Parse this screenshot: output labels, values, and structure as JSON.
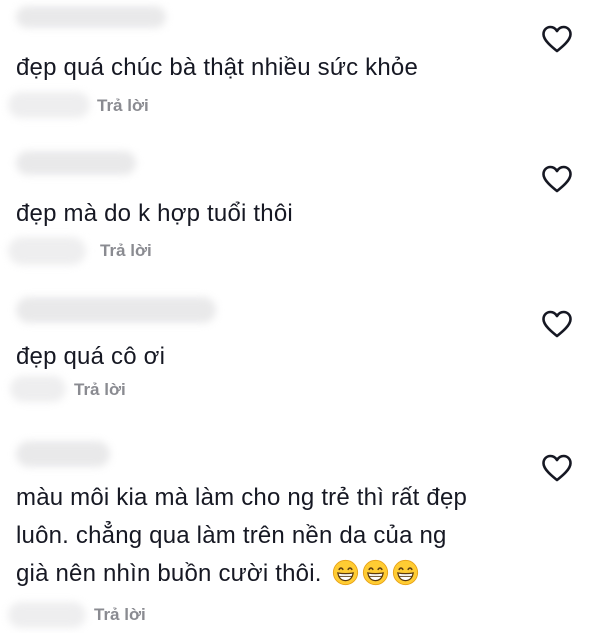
{
  "comments": [
    {
      "text": [
        "đẹp quá chúc bà thật nhiều sức khỏe"
      ],
      "reply_label": "Trả lời"
    },
    {
      "text": [
        "đẹp mà do k hợp tuổi thôi"
      ],
      "reply_label": "Trả lời"
    },
    {
      "text": [
        "đẹp quá cô ơi"
      ],
      "reply_label": "Trả lời"
    },
    {
      "text": [
        "màu môi kia mà làm cho ng trẻ thì rất đẹp",
        "luôn. chẳng qua làm trên nền da của ng",
        "già nên nhìn buồn cười thôi."
      ],
      "emoji": "grinning-face-with-smiling-eyes",
      "emoji_count": 3,
      "reply_label": "Trả lời"
    }
  ],
  "icons": {
    "like": "heart-outline-icon"
  },
  "colors": {
    "text": "#161823",
    "reply": "#8a8b91",
    "heart": "#161823"
  }
}
